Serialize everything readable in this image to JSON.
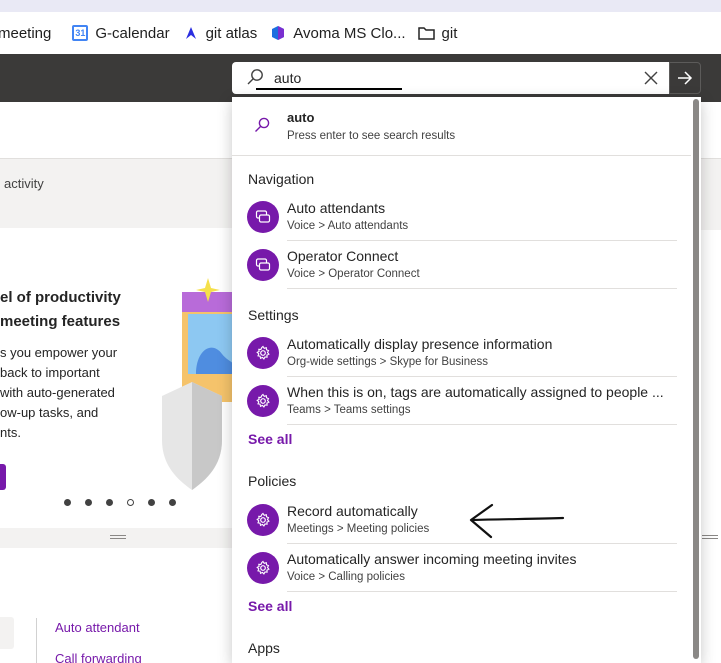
{
  "bookmarks": [
    {
      "label": "meeting",
      "icon": "bookmark-icon"
    },
    {
      "label": "G-calendar",
      "icon": "calendar-icon",
      "icon_text": "31"
    },
    {
      "label": "git atlas",
      "icon": "atlas-icon"
    },
    {
      "label": "Avoma MS Clo...",
      "icon": "avoma-icon"
    },
    {
      "label": "git",
      "icon": "folder-icon"
    }
  ],
  "search": {
    "value": "auto",
    "placeholder": "",
    "go_icon": "arrow-right-icon",
    "clear_icon": "close-icon"
  },
  "suggestion": {
    "title": "auto",
    "subtitle": "Press enter to see search results"
  },
  "sections": {
    "navigation": {
      "title": "Navigation",
      "items": [
        {
          "title": "Auto attendants",
          "subtitle": "Voice > Auto attendants"
        },
        {
          "title": "Operator Connect",
          "subtitle": "Voice > Operator Connect"
        }
      ]
    },
    "settings": {
      "title": "Settings",
      "items": [
        {
          "title": "Automatically display presence information",
          "subtitle": "Org-wide settings > Skype for Business"
        },
        {
          "title": "When this is on, tags are automatically assigned to people ...",
          "subtitle": "Teams > Teams settings"
        }
      ],
      "see_all": "See all"
    },
    "policies": {
      "title": "Policies",
      "items": [
        {
          "title": "Record automatically",
          "subtitle": "Meetings > Meeting policies"
        },
        {
          "title": "Automatically answer incoming meeting invites",
          "subtitle": "Voice > Calling policies"
        }
      ],
      "see_all": "See all"
    },
    "apps": {
      "title": "Apps"
    }
  },
  "background": {
    "activity_text": "activity",
    "headline_line1": "el of productivity",
    "headline_line2": "meeting features",
    "body_lines": [
      "s you empower your",
      "back to important",
      "with auto-generated",
      "ow-up tasks, and",
      "nts."
    ],
    "links": [
      "Auto attendant",
      "Call forwarding"
    ],
    "carousel_dots": 6,
    "active_dot": 4
  },
  "colors": {
    "accent": "#7719aa",
    "header": "#3b3a39"
  }
}
